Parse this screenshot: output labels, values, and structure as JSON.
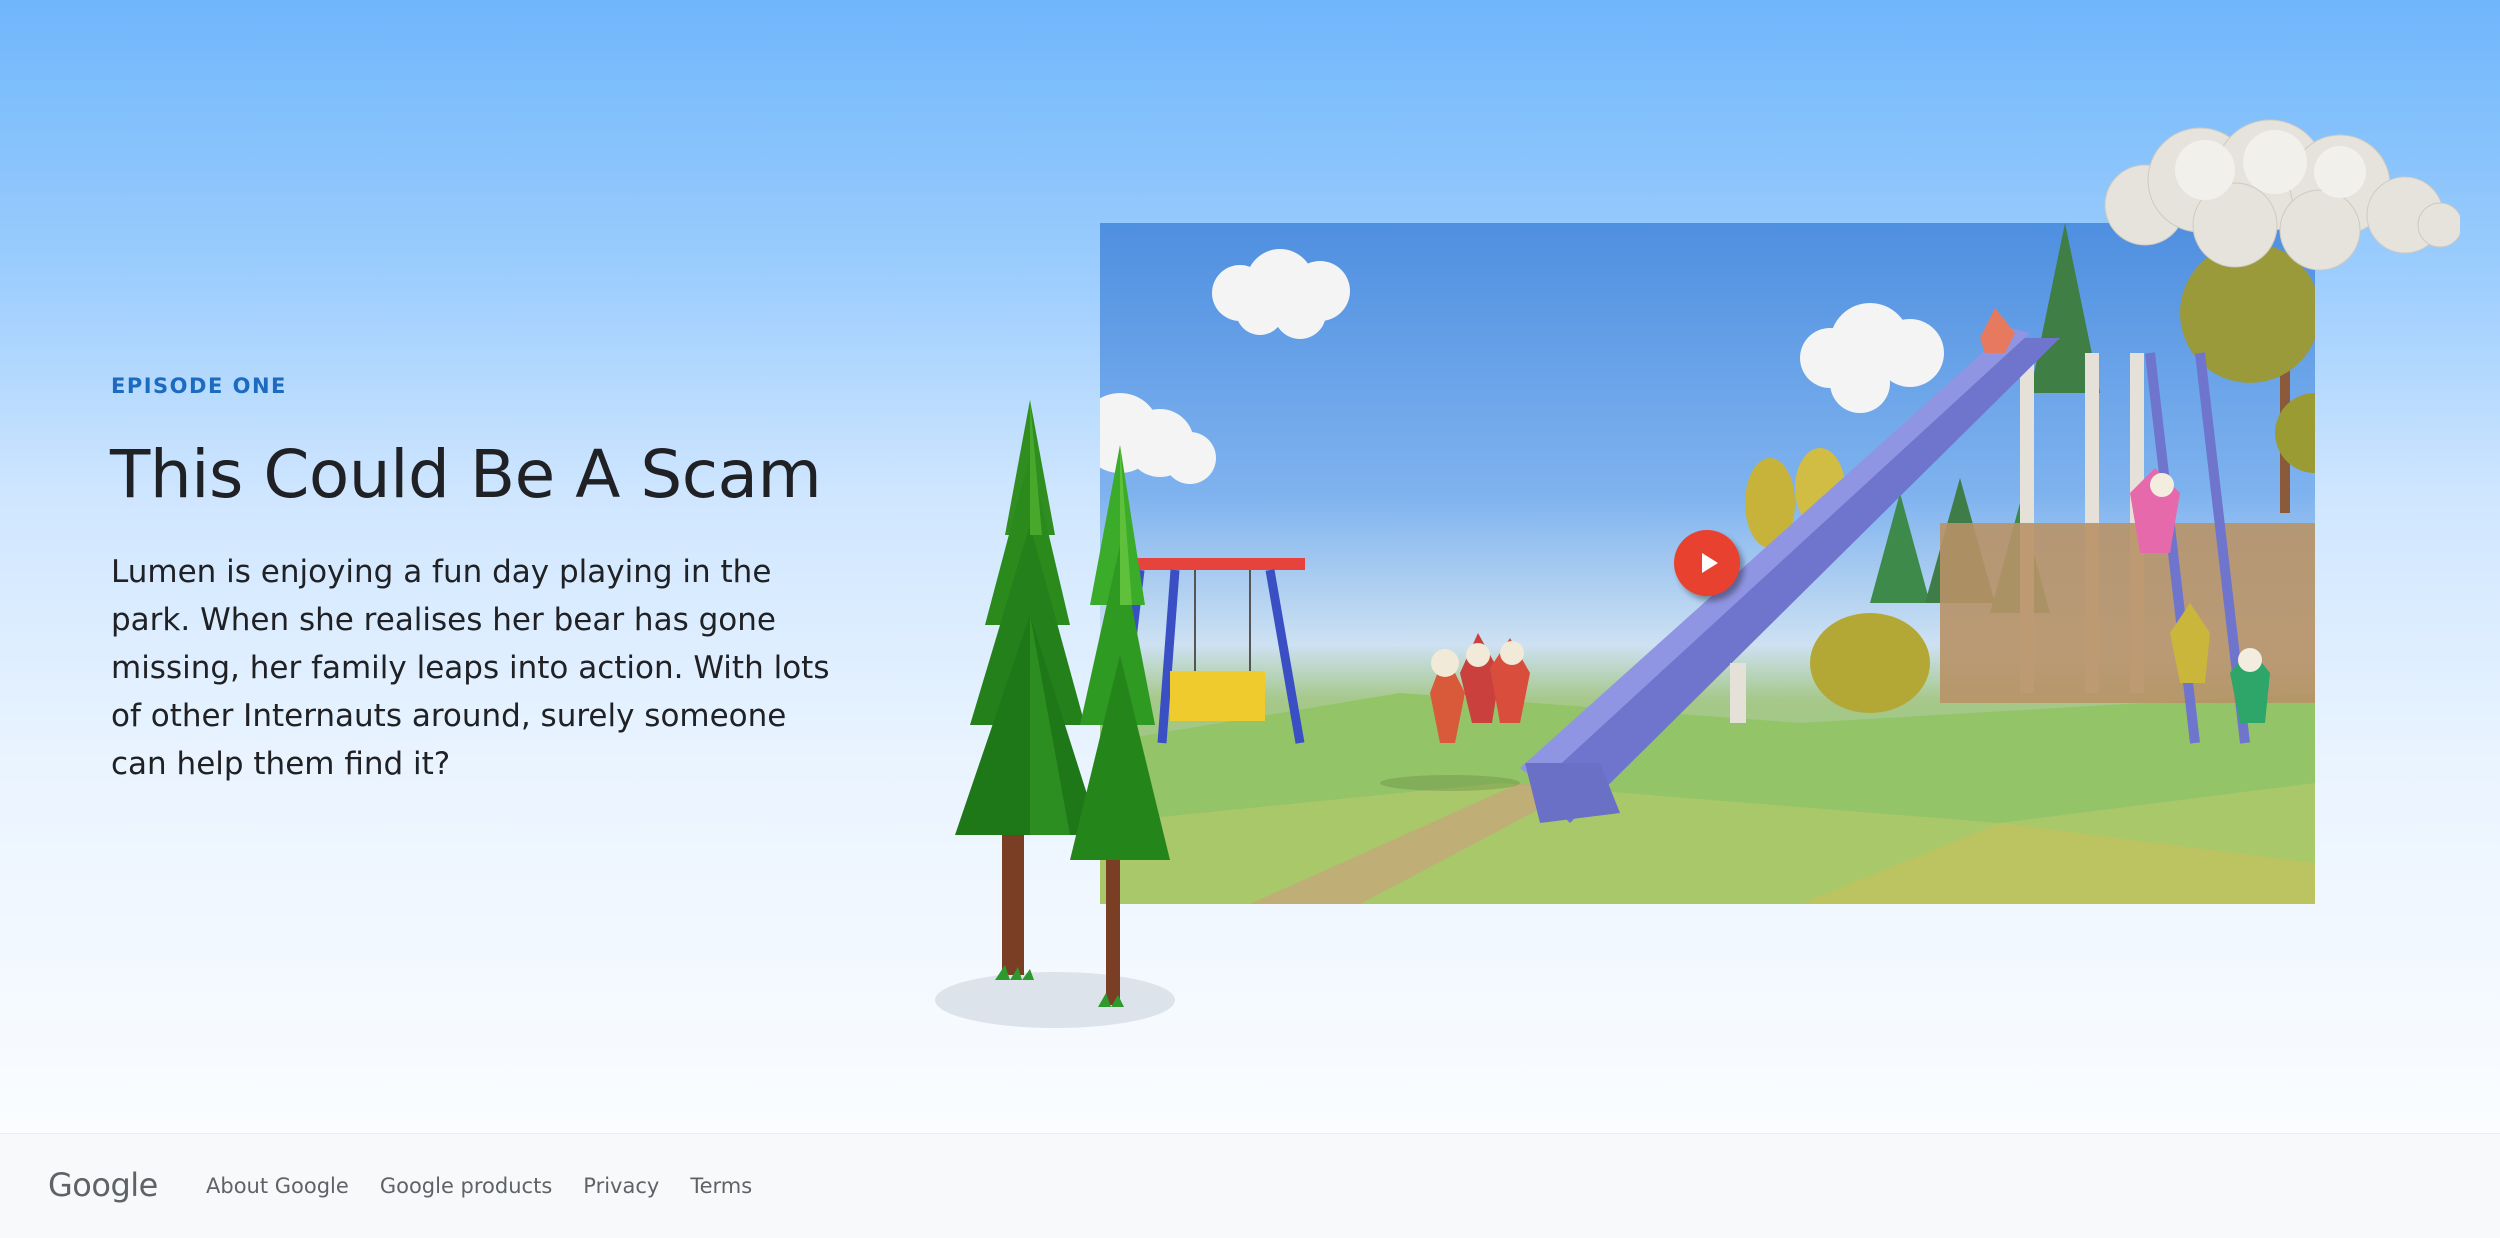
{
  "episode": {
    "eyebrow": "EPISODE ONE",
    "title": "This Could Be A Scam",
    "description": "Lumen is enjoying a fun day playing in the park. When she realises her bear has gone missing, her family leaps into action. With lots of other Internauts around, surely someone can help them find it?"
  },
  "video": {
    "play_icon": "play-icon",
    "play_color": "#e8412f"
  },
  "footer": {
    "logo": "Google",
    "links": [
      "About Google",
      "Google products",
      "Privacy",
      "Terms"
    ]
  },
  "colors": {
    "eyebrow": "#1c6bbf",
    "title": "#202124",
    "footer_bg": "#f8f9fa",
    "footer_text": "#5f6368"
  }
}
